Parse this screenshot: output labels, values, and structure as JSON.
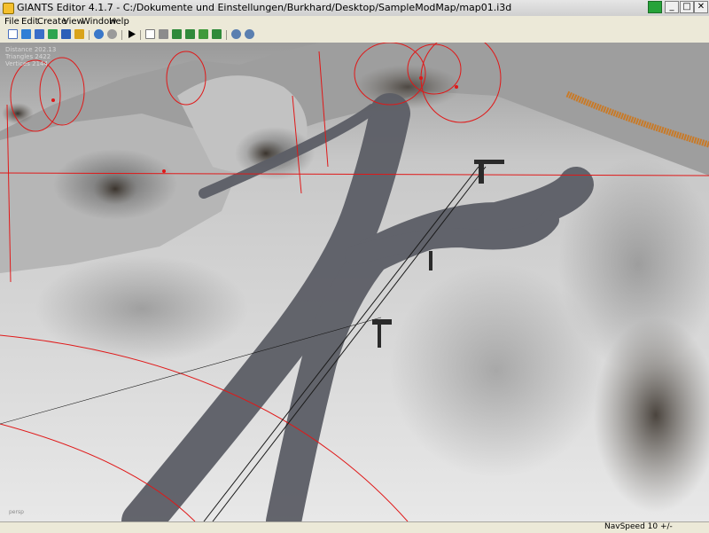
{
  "window": {
    "title": "GIANTS Editor 4.1.7 - C:/Dokumente und Einstellungen/Burkhard/Desktop/SampleModMap/map01.i3d",
    "minimize_glyph": "_",
    "maximize_glyph": "□",
    "close_glyph": "✕"
  },
  "menu": {
    "file": "File",
    "edit": "Edit",
    "create": "Create",
    "view": "View",
    "window": "Window",
    "help": "Help"
  },
  "toolbar": {
    "icons": [
      "new-file-icon",
      "open-file-icon",
      "save-icon",
      "reload-icon",
      "save-as-icon",
      "export-icon",
      "undo-icon",
      "redo-icon",
      "play-icon",
      "select-icon",
      "move-icon",
      "terrain-paint-icon",
      "terrain-sculpt-icon",
      "foliage-icon",
      "terrain-smooth-icon",
      "settings-icon",
      "grid-icon"
    ]
  },
  "viewport": {
    "stats": {
      "distance": "Distance 202.13",
      "triangles": "Triangles 2422",
      "vertices": "Vertices 2144"
    },
    "corner_mark": "persp"
  },
  "statusbar": {
    "navspeed": "NavSpeed 10 +/-"
  },
  "colors": {
    "gizmo_red": "#e01818",
    "snow": "#e6e6e6",
    "track": "#5c5e66",
    "fence_orange": "#c87a28"
  }
}
